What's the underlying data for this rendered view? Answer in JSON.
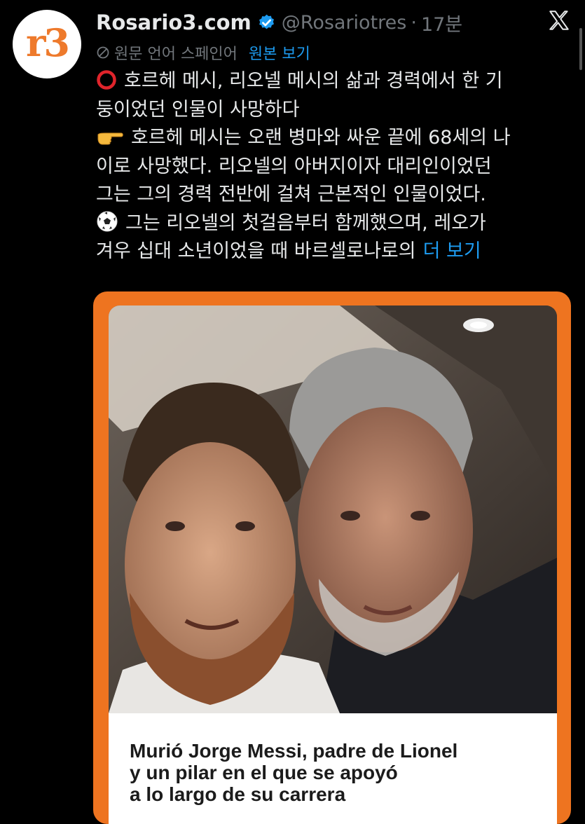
{
  "tweet": {
    "avatar_text": "r3",
    "display_name": "Rosario3.com",
    "handle": "@Rosariotres",
    "separator": "·",
    "time": "17분",
    "translation_label": "원문 언어 스페인어",
    "translation_link": "원본 보기",
    "lines": [
      "호르헤 메시, 리오넬 메시의 삶과 경력에서 한 기",
      "둥이었던 인물이 사망하다",
      "호르헤 메시는 오랜 병마와 싸운 끝에 68세의 나",
      "이로 사망했다. 리오넬의 아버지이자 대리인이었던",
      "그는 그의 경력 전반에 걸쳐 근본적인 인물이었다.",
      "그는 리오넬의 첫걸음부터 함께했으며, 레오가",
      "겨우 십대 소년이었을 때 바르셀로나로의"
    ],
    "more_link": "더 보기"
  },
  "card": {
    "caption_lines": [
      "Murió Jorge Messi, padre de Lionel",
      "y un pilar en el que se apoyó",
      "a lo largo de su carrera"
    ]
  },
  "icons": {
    "verified": "verified-badge-icon",
    "x_logo": "x-logo-icon",
    "no_entry": "translate-no-entry-icon",
    "red_circle": "red-circle-emoji",
    "pointing_hand": "pointing-hand-emoji",
    "soccer_ball": "soccer-ball-emoji"
  },
  "colors": {
    "background": "#000000",
    "text": "#e7e9ea",
    "muted": "#71767b",
    "link": "#1d9bf0",
    "brand_orange": "#ee7420"
  }
}
